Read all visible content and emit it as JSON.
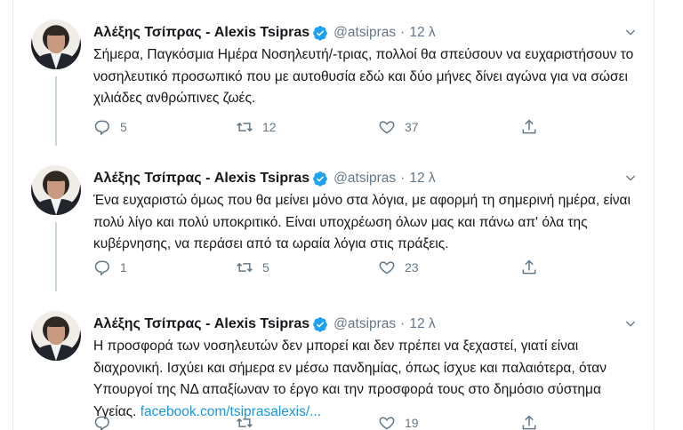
{
  "tweets": [
    {
      "name": "Αλέξης Τσίπρας - Alexis Tsipras",
      "handle": "@atsipras",
      "separator": "·",
      "time": "12 λ",
      "text": "Σήμερα, Παγκόσμια Ημέρα Νοσηλευτή/-τριας, πολλοί θα σπεύσουν να ευχαριστήσουν το νοσηλευτικό προσωπικό που με αυτοθυσία εδώ και δύο μήνες δίνει αγώνα για να σώσει χιλιάδες ανθρώπινες ζωές.",
      "link": "",
      "replies": "5",
      "retweets": "12",
      "likes": "37"
    },
    {
      "name": "Αλέξης Τσίπρας - Alexis Tsipras",
      "handle": "@atsipras",
      "separator": "·",
      "time": "12 λ",
      "text": "Ένα ευχαριστώ όμως που θα μείνει μόνο στα λόγια, με αφορμή τη σημερινή ημέρα, είναι πολύ λίγο και πολύ υποκριτικό. Είναι υποχρέωση όλων μας και πάνω απ' όλα της κυβέρνησης, να περάσει από τα ωραία λόγια στις πράξεις.",
      "link": "",
      "replies": "1",
      "retweets": "5",
      "likes": "23"
    },
    {
      "name": "Αλέξης Τσίπρας - Alexis Tsipras",
      "handle": "@atsipras",
      "separator": "·",
      "time": "12 λ",
      "text": "Η προσφορά των νοσηλευτών δεν μπορεί και δεν πρέπει να ξεχαστεί, γιατί είναι διαχρονική. Ισχύει και σήμερα εν μέσω πανδημίας, όπως ίσχυε και παλαιότερα, όταν Υπουργοί της ΝΔ απαξίωναν το έργο και την προσφορά τους στο δημόσιο σύστημα Υγείας.",
      "link": "facebook.com/tsiprasalexis/...",
      "replies": "",
      "retweets": "",
      "likes": "19"
    }
  ],
  "colors": {
    "text": "#14171a",
    "muted": "#657786",
    "link": "#1b95e0",
    "verified": "#1da1f2",
    "thread_line": "#ccd6dd"
  },
  "icons": [
    "verified-badge-icon",
    "chevron-down-icon",
    "reply-icon",
    "retweet-icon",
    "like-icon",
    "share-icon"
  ]
}
